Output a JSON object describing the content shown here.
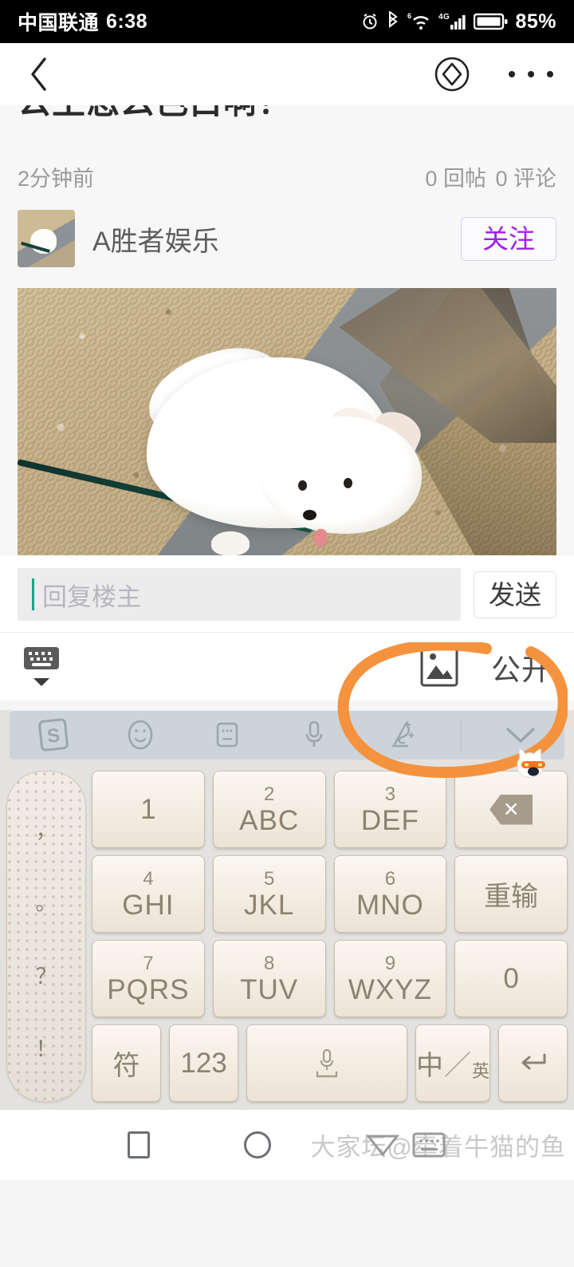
{
  "status_bar": {
    "carrier": "中国联通",
    "time": "6:38",
    "battery_percent": "85%",
    "icons": [
      "alarm-icon",
      "bluetooth-icon",
      "wifi-icon",
      "signal-4g-icon",
      "battery-icon"
    ],
    "network_label": "4G",
    "wifi_superscript": "6"
  },
  "navbar": {
    "back_icon": "chevron-left-icon",
    "gem_icon": "diamond-circle-icon",
    "more_icon": "more-dots-icon"
  },
  "post": {
    "title": "公主怎么色白啊！",
    "time_ago": "2分钟前",
    "reply_count_label": "0 回帖",
    "comment_count_label": "0 评论",
    "author": "A胜者娱乐",
    "follow_label": "关注",
    "follow_color": "#a020f0",
    "image_alt": "white-puppy-on-leash-photo"
  },
  "reply": {
    "placeholder": "回复楼主",
    "value": "",
    "send_label": "发送",
    "caret_color": "#14a58c"
  },
  "toolbar": {
    "keyboard_hide_icon": "keyboard-hide-icon",
    "image_icon": "image-picker-icon",
    "visibility_label": "公开"
  },
  "annotation": {
    "color": "#f5923e",
    "shape": "hand-drawn-ellipse"
  },
  "mascot": {
    "icon": "fox-mascot-icon"
  },
  "keyboard": {
    "name": "sogou-t9-keyboard",
    "toolbar_items": [
      {
        "name": "sogou-logo-icon",
        "label": "S"
      },
      {
        "name": "emoji-icon",
        "label": ""
      },
      {
        "name": "keyboard-layout-icon",
        "label": ""
      },
      {
        "name": "microphone-icon",
        "label": ""
      },
      {
        "name": "handwriting-icon",
        "label": ""
      },
      {
        "name": "collapse-chevron-icon",
        "label": ""
      }
    ],
    "punctuation_key": [
      "，",
      "。",
      "？",
      "！"
    ],
    "rows": [
      [
        {
          "num": "",
          "alpha": "1",
          "name": "key-1"
        },
        {
          "num": "2",
          "alpha": "ABC",
          "name": "key-2-abc"
        },
        {
          "num": "3",
          "alpha": "DEF",
          "name": "key-3-def"
        },
        {
          "num": "",
          "alpha": "",
          "name": "key-backspace"
        }
      ],
      [
        {
          "num": "4",
          "alpha": "GHI",
          "name": "key-4-ghi"
        },
        {
          "num": "5",
          "alpha": "JKL",
          "name": "key-5-jkl"
        },
        {
          "num": "6",
          "alpha": "MNO",
          "name": "key-6-mno"
        },
        {
          "num": "",
          "alpha": "重输",
          "name": "key-redo"
        }
      ],
      [
        {
          "num": "7",
          "alpha": "PQRS",
          "name": "key-7-pqrs"
        },
        {
          "num": "8",
          "alpha": "TUV",
          "name": "key-8-tuv"
        },
        {
          "num": "9",
          "alpha": "WXYZ",
          "name": "key-9-wxyz"
        },
        {
          "num": "",
          "alpha": "0",
          "name": "key-0"
        }
      ],
      [
        {
          "num": "",
          "alpha": "符",
          "name": "key-symbols"
        },
        {
          "num": "",
          "alpha": "123",
          "name": "key-numbers"
        },
        {
          "num": "",
          "alpha": "",
          "name": "key-space"
        },
        {
          "num": "",
          "alpha": "中/英",
          "name": "key-lang-toggle"
        },
        {
          "num": "",
          "alpha": "",
          "name": "key-enter"
        }
      ]
    ],
    "lang_toggle": {
      "primary": "中",
      "secondary": "英"
    },
    "redo_label": "重输",
    "symbols_label": "符",
    "numbers_label": "123",
    "zero_label": "0",
    "one_label": "1"
  },
  "android_nav": {
    "recents_icon": "square-recents-icon",
    "home_icon": "circle-home-icon",
    "back_icon": "triangle-back-icon",
    "keyboard_icon": "keyboard-indicator-icon"
  },
  "watermark": {
    "text": "大家坛@牵着牛猫的鱼"
  }
}
